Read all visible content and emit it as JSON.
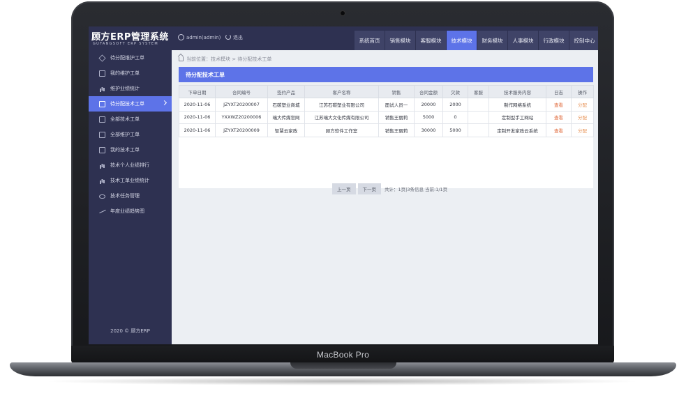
{
  "app": {
    "title": "顾方ERP管理系统",
    "subtitle": "GUFANGSOFT ERP SYSTEM",
    "user": "admin(admin)",
    "logout": "退出",
    "copyright": "2020 © 顾方ERP"
  },
  "device_label": "MacBook Pro",
  "nav": {
    "tabs": [
      "系统首页",
      "销售模块",
      "客服模块",
      "技术模块",
      "财务模块",
      "人事模块",
      "行政模块",
      "控制中心"
    ],
    "active": "技术模块"
  },
  "sidebar": {
    "items": [
      {
        "label": "待分配维护工单",
        "icon": "layers-icon"
      },
      {
        "label": "我的维护工单",
        "icon": "clipboard-icon"
      },
      {
        "label": "维护业绩统计",
        "icon": "bar-chart-icon"
      },
      {
        "label": "待分配技术工单",
        "icon": "document-icon",
        "active": true
      },
      {
        "label": "全部技术工单",
        "icon": "document-icon"
      },
      {
        "label": "全部维护工单",
        "icon": "document-icon"
      },
      {
        "label": "我的技术工单",
        "icon": "calendar-icon"
      },
      {
        "label": "技术个人业绩排行",
        "icon": "bar-chart-icon"
      },
      {
        "label": "技术工单业绩统计",
        "icon": "bar-chart-icon"
      },
      {
        "label": "技术任务管理",
        "icon": "eye-icon"
      },
      {
        "label": "年度业绩趋势图",
        "icon": "trend-icon"
      }
    ]
  },
  "breadcrumb": "当前位置：技术模块 > 待分配技术工单",
  "panel": {
    "title": "待分配技术工单"
  },
  "table": {
    "headers": [
      "下单日期",
      "合同编号",
      "签约产品",
      "客户名称",
      "销售",
      "合同金额",
      "欠款",
      "客服",
      "技术服务内容",
      "日志",
      "操作"
    ],
    "rows": [
      [
        "2020-11-06",
        "JZYXT20200007",
        "石碳塑业商城",
        "江苏石碳塑业有限公司",
        "面试人员一",
        "20000",
        "2000",
        "",
        "制作网络系统",
        "查看",
        "分配"
      ],
      [
        "2020-11-06",
        "YXXWZ20200006",
        "瑞大传媒官网",
        "江苏瑞大文化传媒有限公司",
        "销售王丽莉",
        "5000",
        "0",
        "",
        "定制型手工网站",
        "查看",
        "分配"
      ],
      [
        "2020-11-06",
        "JZYXT20200009",
        "智慧云家政",
        "顾方软件工作室",
        "销售王丽莉",
        "30000",
        "5000",
        "",
        "定制开发家政云系统",
        "查看",
        "分配"
      ]
    ]
  },
  "pager": {
    "prev": "上一页",
    "next": "下一页",
    "info": "共计：1页|3条信息  当前:1/1页"
  },
  "colors": {
    "sidebar_bg": "#2e3151",
    "accent": "#5d73e8",
    "link_orange": "#e06a3b"
  }
}
